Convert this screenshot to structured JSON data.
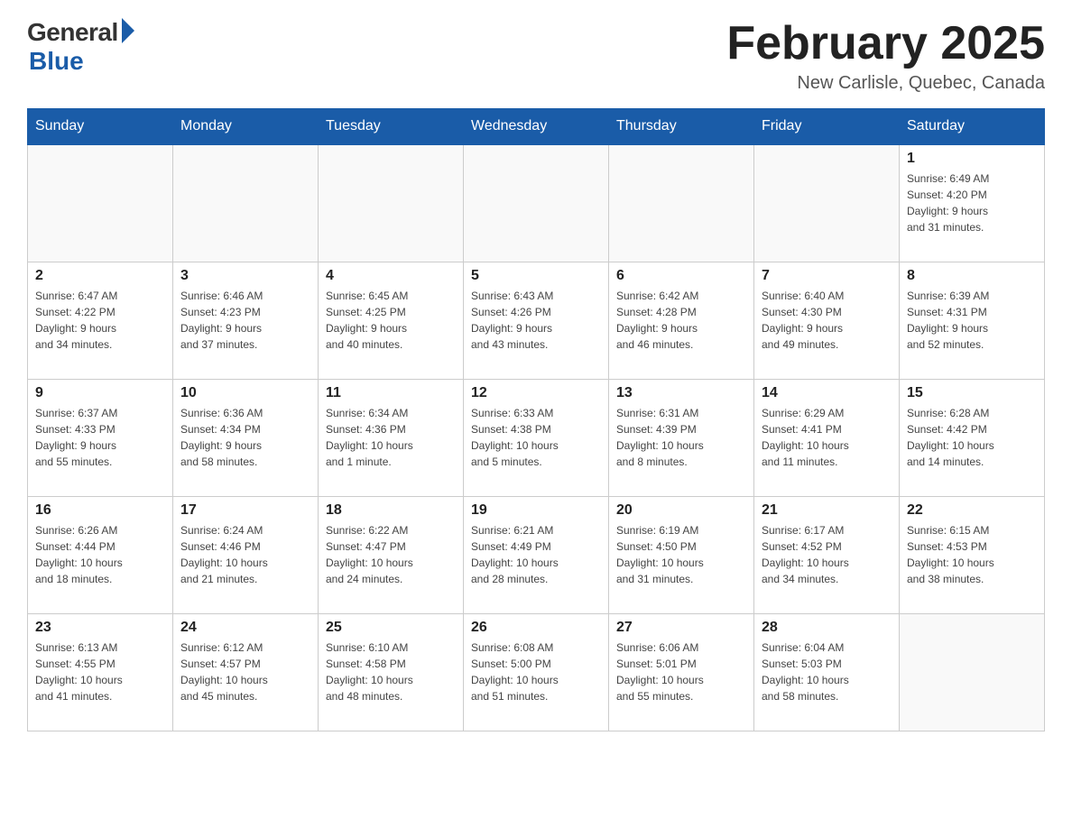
{
  "header": {
    "logo_general": "General",
    "logo_blue": "Blue",
    "title": "February 2025",
    "subtitle": "New Carlisle, Quebec, Canada"
  },
  "weekdays": [
    "Sunday",
    "Monday",
    "Tuesday",
    "Wednesday",
    "Thursday",
    "Friday",
    "Saturday"
  ],
  "weeks": [
    [
      {
        "day": "",
        "info": ""
      },
      {
        "day": "",
        "info": ""
      },
      {
        "day": "",
        "info": ""
      },
      {
        "day": "",
        "info": ""
      },
      {
        "day": "",
        "info": ""
      },
      {
        "day": "",
        "info": ""
      },
      {
        "day": "1",
        "info": "Sunrise: 6:49 AM\nSunset: 4:20 PM\nDaylight: 9 hours\nand 31 minutes."
      }
    ],
    [
      {
        "day": "2",
        "info": "Sunrise: 6:47 AM\nSunset: 4:22 PM\nDaylight: 9 hours\nand 34 minutes."
      },
      {
        "day": "3",
        "info": "Sunrise: 6:46 AM\nSunset: 4:23 PM\nDaylight: 9 hours\nand 37 minutes."
      },
      {
        "day": "4",
        "info": "Sunrise: 6:45 AM\nSunset: 4:25 PM\nDaylight: 9 hours\nand 40 minutes."
      },
      {
        "day": "5",
        "info": "Sunrise: 6:43 AM\nSunset: 4:26 PM\nDaylight: 9 hours\nand 43 minutes."
      },
      {
        "day": "6",
        "info": "Sunrise: 6:42 AM\nSunset: 4:28 PM\nDaylight: 9 hours\nand 46 minutes."
      },
      {
        "day": "7",
        "info": "Sunrise: 6:40 AM\nSunset: 4:30 PM\nDaylight: 9 hours\nand 49 minutes."
      },
      {
        "day": "8",
        "info": "Sunrise: 6:39 AM\nSunset: 4:31 PM\nDaylight: 9 hours\nand 52 minutes."
      }
    ],
    [
      {
        "day": "9",
        "info": "Sunrise: 6:37 AM\nSunset: 4:33 PM\nDaylight: 9 hours\nand 55 minutes."
      },
      {
        "day": "10",
        "info": "Sunrise: 6:36 AM\nSunset: 4:34 PM\nDaylight: 9 hours\nand 58 minutes."
      },
      {
        "day": "11",
        "info": "Sunrise: 6:34 AM\nSunset: 4:36 PM\nDaylight: 10 hours\nand 1 minute."
      },
      {
        "day": "12",
        "info": "Sunrise: 6:33 AM\nSunset: 4:38 PM\nDaylight: 10 hours\nand 5 minutes."
      },
      {
        "day": "13",
        "info": "Sunrise: 6:31 AM\nSunset: 4:39 PM\nDaylight: 10 hours\nand 8 minutes."
      },
      {
        "day": "14",
        "info": "Sunrise: 6:29 AM\nSunset: 4:41 PM\nDaylight: 10 hours\nand 11 minutes."
      },
      {
        "day": "15",
        "info": "Sunrise: 6:28 AM\nSunset: 4:42 PM\nDaylight: 10 hours\nand 14 minutes."
      }
    ],
    [
      {
        "day": "16",
        "info": "Sunrise: 6:26 AM\nSunset: 4:44 PM\nDaylight: 10 hours\nand 18 minutes."
      },
      {
        "day": "17",
        "info": "Sunrise: 6:24 AM\nSunset: 4:46 PM\nDaylight: 10 hours\nand 21 minutes."
      },
      {
        "day": "18",
        "info": "Sunrise: 6:22 AM\nSunset: 4:47 PM\nDaylight: 10 hours\nand 24 minutes."
      },
      {
        "day": "19",
        "info": "Sunrise: 6:21 AM\nSunset: 4:49 PM\nDaylight: 10 hours\nand 28 minutes."
      },
      {
        "day": "20",
        "info": "Sunrise: 6:19 AM\nSunset: 4:50 PM\nDaylight: 10 hours\nand 31 minutes."
      },
      {
        "day": "21",
        "info": "Sunrise: 6:17 AM\nSunset: 4:52 PM\nDaylight: 10 hours\nand 34 minutes."
      },
      {
        "day": "22",
        "info": "Sunrise: 6:15 AM\nSunset: 4:53 PM\nDaylight: 10 hours\nand 38 minutes."
      }
    ],
    [
      {
        "day": "23",
        "info": "Sunrise: 6:13 AM\nSunset: 4:55 PM\nDaylight: 10 hours\nand 41 minutes."
      },
      {
        "day": "24",
        "info": "Sunrise: 6:12 AM\nSunset: 4:57 PM\nDaylight: 10 hours\nand 45 minutes."
      },
      {
        "day": "25",
        "info": "Sunrise: 6:10 AM\nSunset: 4:58 PM\nDaylight: 10 hours\nand 48 minutes."
      },
      {
        "day": "26",
        "info": "Sunrise: 6:08 AM\nSunset: 5:00 PM\nDaylight: 10 hours\nand 51 minutes."
      },
      {
        "day": "27",
        "info": "Sunrise: 6:06 AM\nSunset: 5:01 PM\nDaylight: 10 hours\nand 55 minutes."
      },
      {
        "day": "28",
        "info": "Sunrise: 6:04 AM\nSunset: 5:03 PM\nDaylight: 10 hours\nand 58 minutes."
      },
      {
        "day": "",
        "info": ""
      }
    ]
  ]
}
